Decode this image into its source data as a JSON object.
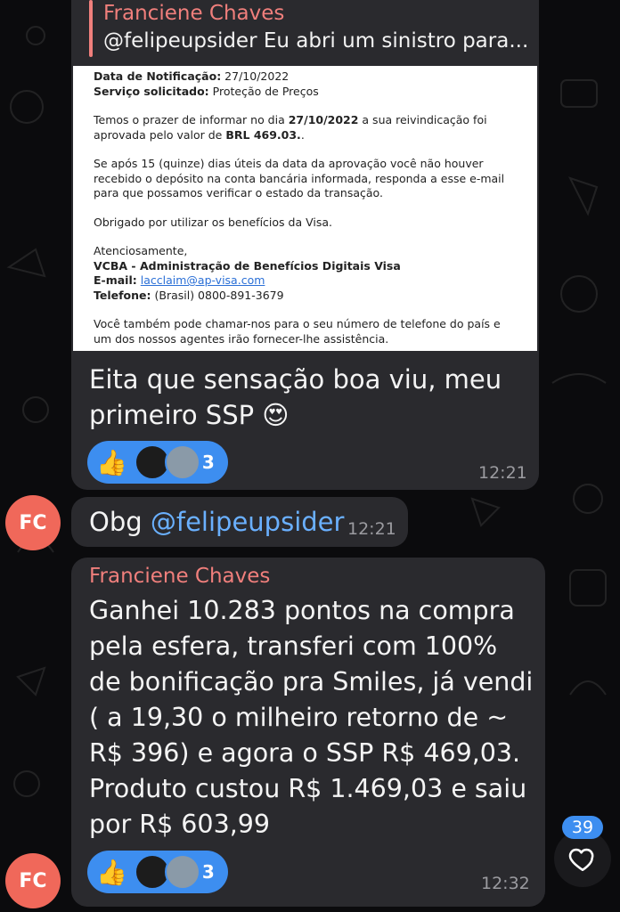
{
  "reply": {
    "sender": "Franciene Chaves",
    "preview": "@felipeupsider Eu abri um sinistro para..."
  },
  "doc": {
    "notif_label": "Data de Notificação:",
    "notif_value": " 27/10/2022",
    "service_label": "Serviço solicitado:",
    "service_value": " Proteção de Preços",
    "p1_a": "Temos o prazer de informar no dia ",
    "p1_date": "27/10/2022",
    "p1_b": " a sua reivindicação foi aprovada pelo valor de ",
    "p1_amount": "BRL 469.03.",
    "p1_c": ".",
    "p2": "Se após 15 (quinze) dias úteis da data da aprovação você não houver recebido o depósito na conta bancária informada, responda a esse e-mail para que possamos verificar o estado da transação.",
    "p3": "Obrigado por utilizar os benefícios da Visa.",
    "regards": "Atenciosamente,",
    "org": "VCBA - Administração de Benefícios Digitais Visa",
    "email_label": "E-mail:",
    "email_value": "lacclaim@ap-visa.com",
    "phone_label": "Telefone:",
    "phone_value": " (Brasil) 0800-891-3679",
    "p4": "Você também pode chamar-nos para o seu número de telefone do país e um dos nossos agentes irão fornecer-lhe assistência."
  },
  "messages": {
    "m1": {
      "text": "Eita que sensação boa viu, meu primeiro SSP 😍",
      "time": "12:21",
      "reaction_emoji": "👍",
      "reaction_count": "3"
    },
    "m2": {
      "text": "Obg ",
      "mention": "@felipeupsider",
      "time": "12:21"
    },
    "m3": {
      "sender": "Franciene Chaves",
      "text": "Ganhei 10.283 pontos na compra pela esfera, transferi com 100% de bonificação pra Smiles, já vendi ( a 19,30 o milheiro retorno de ~ R$ 396) e agora o SSP R$ 469,03. Produto custou R$ 1.469,03 e saiu por R$ 603,99",
      "time": "12:32",
      "reaction_emoji": "👍",
      "reaction_count": "3"
    }
  },
  "avatar_initials": "FC",
  "unread_badge": "39",
  "colors": {
    "background": "#0b0b0d",
    "bubble": "#2a2a2e",
    "sender_name": "#f07f7c",
    "avatar": "#f0685a",
    "reaction": "#3d8ef0",
    "mention": "#6ab0ff"
  },
  "icons": {
    "heart": "heart-icon"
  }
}
